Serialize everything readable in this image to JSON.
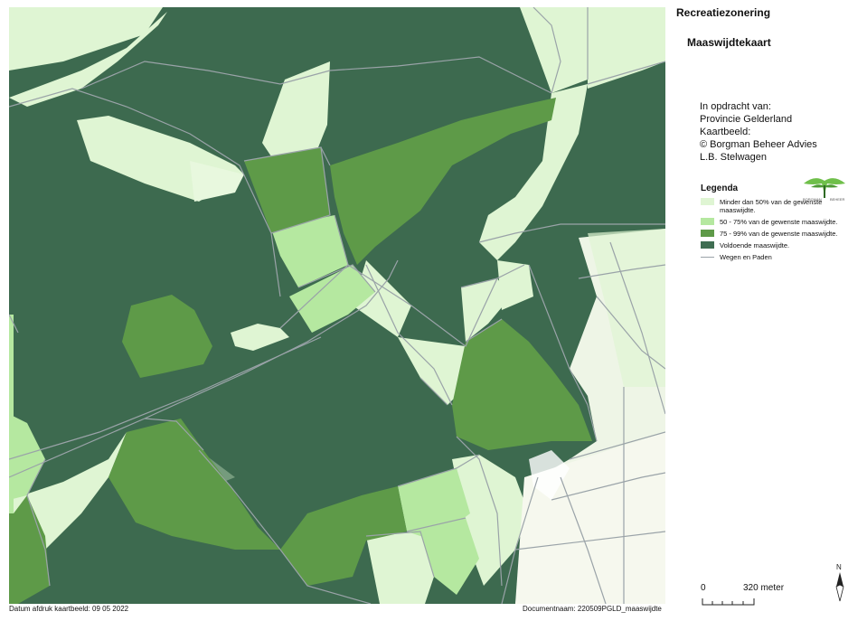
{
  "header": {
    "title": "Recreatiezonering",
    "subtitle": "Maaswijdtekaart"
  },
  "credits": [
    "In opdracht van:",
    "Provincie Gelderland",
    "Kaartbeeld:",
    "© Borgman Beheer Advies",
    "L.B. Stelwagen"
  ],
  "legend": {
    "title": "Legenda",
    "items": [
      {
        "label": "Minder dan 50% van de gewenste maaswijdte.",
        "color": "#dff5d3"
      },
      {
        "label": "50 - 75% van de gewenste maaswijdte.",
        "color": "#b5e8a0"
      },
      {
        "label": "75 - 99% van de gewenste maaswijdte.",
        "color": "#5e9a48"
      },
      {
        "label": "Voldoende maaswijdte.",
        "color": "#3f6e52"
      },
      {
        "label": "Wegen en Paden",
        "color": "#9aa3a8"
      }
    ]
  },
  "logo": {
    "line1": "BORGMAN",
    "line2": "BEHEER",
    "icon": "tree-logo-icon"
  },
  "scale": {
    "start": "0",
    "end": "320 meter"
  },
  "north_arrow": {
    "label": "N",
    "icon": "north-arrow-icon"
  },
  "footer": {
    "print_date": "Datum afdruk kaartbeeld: 09 05 2022",
    "document_name": "Documentnaam: 220509PGLD_maaswijdte"
  },
  "colors": {
    "voldoende": "#3f6e52",
    "v75_99": "#5e9a48",
    "v50_75": "#b5e8a0",
    "lt50": "#dff5d3",
    "urban": "#f6f8ee",
    "roads": "#9aa3a8"
  }
}
